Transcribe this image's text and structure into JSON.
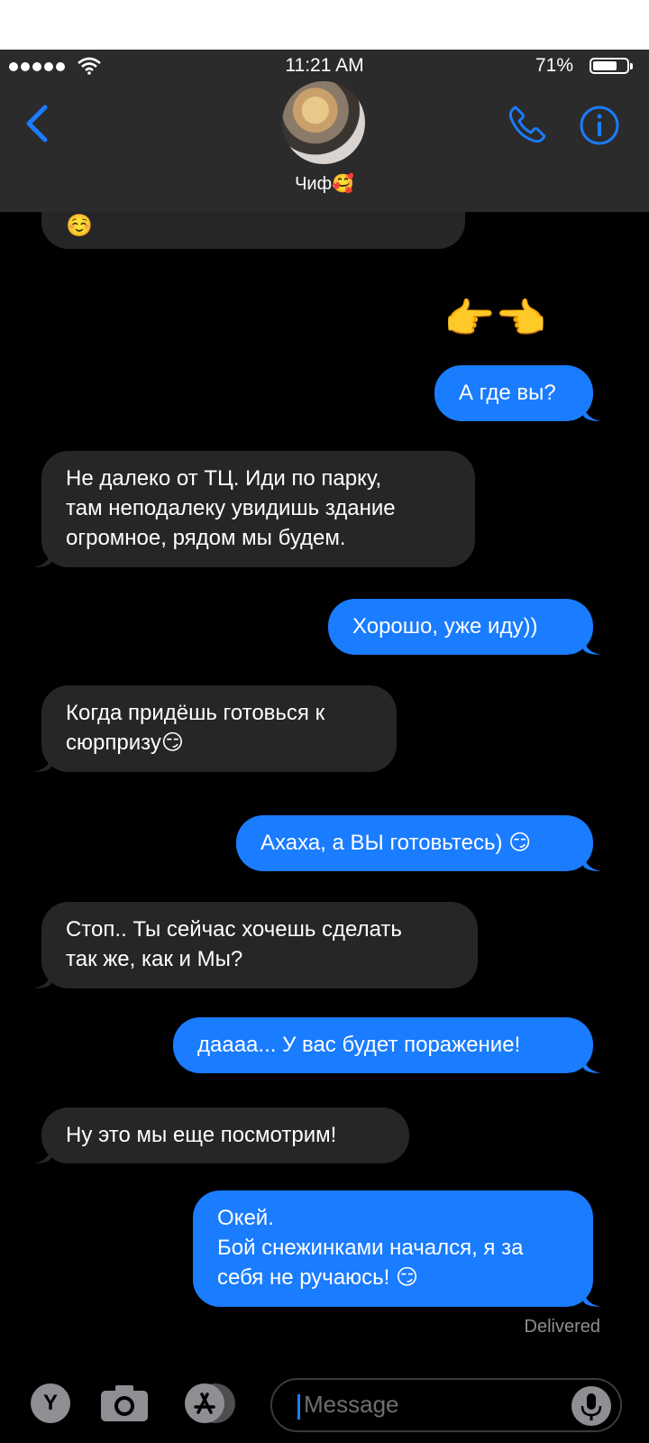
{
  "status_bar": {
    "time": "11:21 AM",
    "battery_percent": "71%",
    "battery_level": 0.71,
    "signal_bars": 5,
    "wifi": "wifi-icon"
  },
  "header": {
    "contact_name": "Чиф🥰",
    "icons": [
      "back-chevron-icon",
      "phone-icon",
      "info-icon"
    ]
  },
  "messages": [
    {
      "from": "them",
      "text": [
        "☺️"
      ]
    },
    {
      "from": "me",
      "emoji_only": true,
      "text": [
        "👉👈"
      ]
    },
    {
      "from": "me",
      "text": [
        "А где вы?"
      ]
    },
    {
      "from": "them",
      "text": [
        "Не далеко от ТЦ. Иди по парку,",
        "там неподалеку увидишь здание",
        "огромное, рядом мы будем."
      ]
    },
    {
      "from": "me",
      "text": [
        "Хорошо, уже иду))"
      ]
    },
    {
      "from": "them",
      "text": [
        "Когда придёшь готовься к",
        "сюрпризу😏"
      ]
    },
    {
      "from": "me",
      "text": [
        "Ахаха, а ВЫ готовьтесь) 😏"
      ]
    },
    {
      "from": "them",
      "text": [
        "Стоп.. Ты сейчас хочешь сделать",
        "так же, как и Мы?"
      ]
    },
    {
      "from": "me",
      "text": [
        "даааа... У вас будет поражение!"
      ]
    },
    {
      "from": "them",
      "text": [
        "Ну это мы еще посмотрим!"
      ]
    },
    {
      "from": "me",
      "text": [
        "Окей.",
        "Бой снежинками начался, я за",
        "себя не ручаюсь! 😏"
      ]
    }
  ],
  "delivered_label": "Delivered",
  "input_bar": {
    "app_button_letter": "Y",
    "placeholder": "Message",
    "icons": [
      "camera-icon",
      "app-store-icon",
      "microphone-icon"
    ]
  },
  "colors": {
    "outgoing": "#1a7cff",
    "incoming": "#262628",
    "background": "#000000",
    "header": "#2b2b2c"
  }
}
